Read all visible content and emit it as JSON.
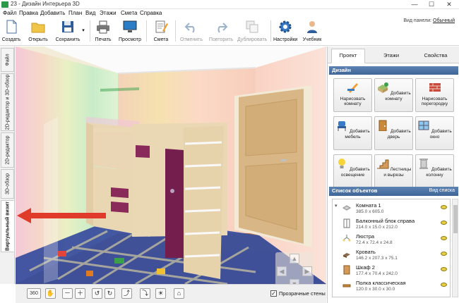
{
  "window": {
    "title": "23 - Дизайн Интерьера 3D",
    "min": "—",
    "max": "☐",
    "close": "✕"
  },
  "menu": [
    "Файл",
    "Правка",
    "Добавить",
    "План",
    "Вид",
    "Этажи",
    "Смета",
    "Справка"
  ],
  "panel_view": {
    "label": "Вид панели:",
    "value": "Обычный"
  },
  "toolbar": {
    "create": "Создать",
    "open": "Открыть",
    "save": "Сохранить",
    "print": "Печать",
    "preview": "Просмотр",
    "estimate": "Смета",
    "undo": "Отменить",
    "redo": "Повторить",
    "duplicate": "Дублировать",
    "settings": "Настройки",
    "tutorial": "Учебник"
  },
  "left_tabs": [
    "Файл",
    "2D-редактор и 3D-обзор",
    "2D-редактор",
    "3D-обзор",
    "Виртуальный визит"
  ],
  "right_tabs": [
    "Проект",
    "Этажи",
    "Свойства"
  ],
  "design": {
    "header": "Дизайн",
    "buttons": [
      {
        "label": "Нарисовать комнату",
        "icon": "pencil-ruler-icon"
      },
      {
        "label": "Добавить комнату",
        "icon": "add-room-icon"
      },
      {
        "label": "Нарисовать перегородку",
        "icon": "brick-wall-icon"
      },
      {
        "label": "Добавить мебель",
        "icon": "chair-icon"
      },
      {
        "label": "Добавить дверь",
        "icon": "door-icon"
      },
      {
        "label": "Добавить окно",
        "icon": "window-icon"
      },
      {
        "label": "Добавить освещение",
        "icon": "lightbulb-icon"
      },
      {
        "label": "Лестницы и вырезы",
        "icon": "stairs-icon"
      },
      {
        "label": "Добавить колонну",
        "icon": "column-icon"
      }
    ]
  },
  "objects": {
    "header": "Список объектов",
    "view_list": "Вид списка",
    "items": [
      {
        "name": "Комната 1",
        "dims": "385.0 x 605.0"
      },
      {
        "name": "Балконный блок справа",
        "dims": "214.0 x 15.0 x 212.0"
      },
      {
        "name": "Люстра",
        "dims": "72.4 x 72.4 x 24.8"
      },
      {
        "name": "Кровать",
        "dims": "146.2 x 207.3 x 75.1"
      },
      {
        "name": "Шкаф 2",
        "dims": "177.4 x 70.4 x 242.0"
      },
      {
        "name": "Полка классическая",
        "dims": "120.0 x 30.0 x 30.0"
      }
    ]
  },
  "bottom": {
    "btn_360": "360",
    "transparent_walls": "Прозрачные стены",
    "transparent_checked": "✓"
  },
  "colors": {
    "accent_header": "#4a6fa0",
    "arrow": "#e03a2a"
  }
}
